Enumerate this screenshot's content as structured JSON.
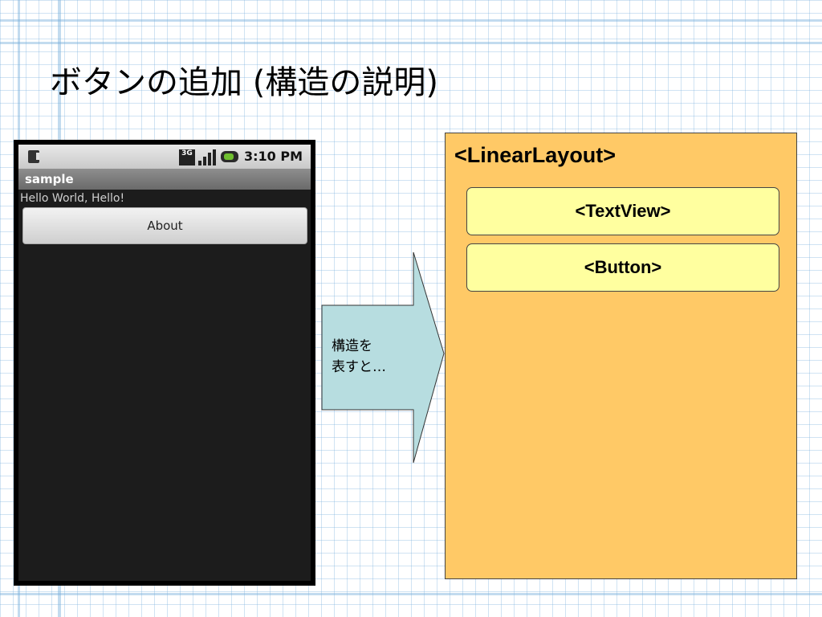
{
  "slide": {
    "title": "ボタンの追加 (構造の説明)"
  },
  "phone": {
    "status_time": "3:10 PM",
    "network_label": "3G",
    "app_title": "sample",
    "hello_text": "Hello World, Hello!",
    "about_button_label": "About"
  },
  "arrow": {
    "label": "構造を\n表すと…",
    "fill_color": "#b7dde0"
  },
  "layout_diagram": {
    "root_label": "<LinearLayout>",
    "root_color": "#ffc966",
    "children": [
      {
        "label": "<TextView>"
      },
      {
        "label": "<Button>"
      }
    ],
    "child_color": "#ffff9f"
  }
}
